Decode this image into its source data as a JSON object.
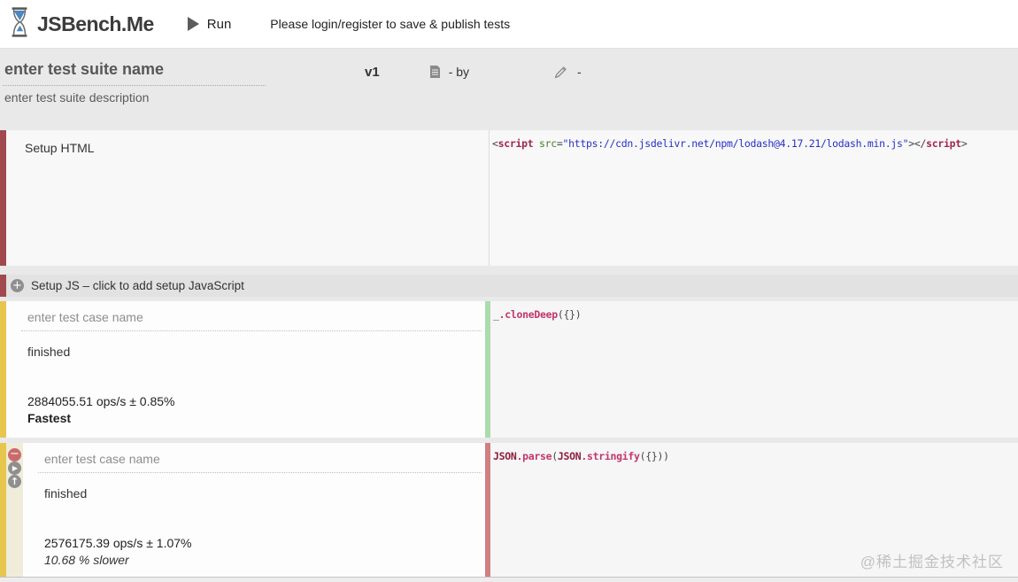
{
  "header": {
    "logo_text": "JSBench.Me",
    "run_label": "Run",
    "login_notice": "Please login/register to save & publish tests"
  },
  "suite": {
    "name_placeholder": "enter test suite name",
    "version": "v1",
    "by_label": "- by",
    "owner_value": "-",
    "description_placeholder": "enter test suite description"
  },
  "setup_html": {
    "label": "Setup HTML",
    "code_tokens": [
      {
        "t": "<",
        "c": "punct"
      },
      {
        "t": "script",
        "c": "tag"
      },
      {
        "t": " ",
        "c": "punct"
      },
      {
        "t": "src",
        "c": "attr"
      },
      {
        "t": "=",
        "c": "punct"
      },
      {
        "t": "\"https://cdn.jsdelivr.net/npm/lodash@4.17.21/lodash.min.js\"",
        "c": "string"
      },
      {
        "t": ">",
        "c": "punct"
      },
      {
        "t": "</",
        "c": "punct"
      },
      {
        "t": "script",
        "c": "tag"
      },
      {
        "t": ">",
        "c": "punct"
      }
    ]
  },
  "setup_js": {
    "label": "Setup JS – click to add setup JavaScript"
  },
  "test_cases": [
    {
      "name_placeholder": "enter test case name",
      "status": "finished",
      "ops": "2884055.51 ops/s ± 0.85%",
      "verdict": "Fastest",
      "code_tokens": [
        {
          "t": "_",
          "c": "punct"
        },
        {
          "t": ".cloneDeep",
          "c": "method"
        },
        {
          "t": "({})",
          "c": "punct"
        }
      ]
    },
    {
      "name_placeholder": "enter test case name",
      "status": "finished",
      "ops": "2576175.39 ops/s ± 1.07%",
      "verdict": "10.68 % slower",
      "code_tokens": [
        {
          "t": "JSON",
          "c": "builtin"
        },
        {
          "t": ".parse",
          "c": "method"
        },
        {
          "t": "(",
          "c": "punct"
        },
        {
          "t": "JSON",
          "c": "builtin"
        },
        {
          "t": ".stringify",
          "c": "method"
        },
        {
          "t": "({}))",
          "c": "punct"
        }
      ]
    }
  ],
  "icons": {
    "plus": "+",
    "minus": "−",
    "play": "▶",
    "up": "↑"
  },
  "colors": {
    "accent_maroon": "#a04a50",
    "accent_yellow": "#e7c64e",
    "divider_green": "#abdcab",
    "divider_red": "#d08080"
  },
  "watermark": "@稀土掘金技术社区"
}
